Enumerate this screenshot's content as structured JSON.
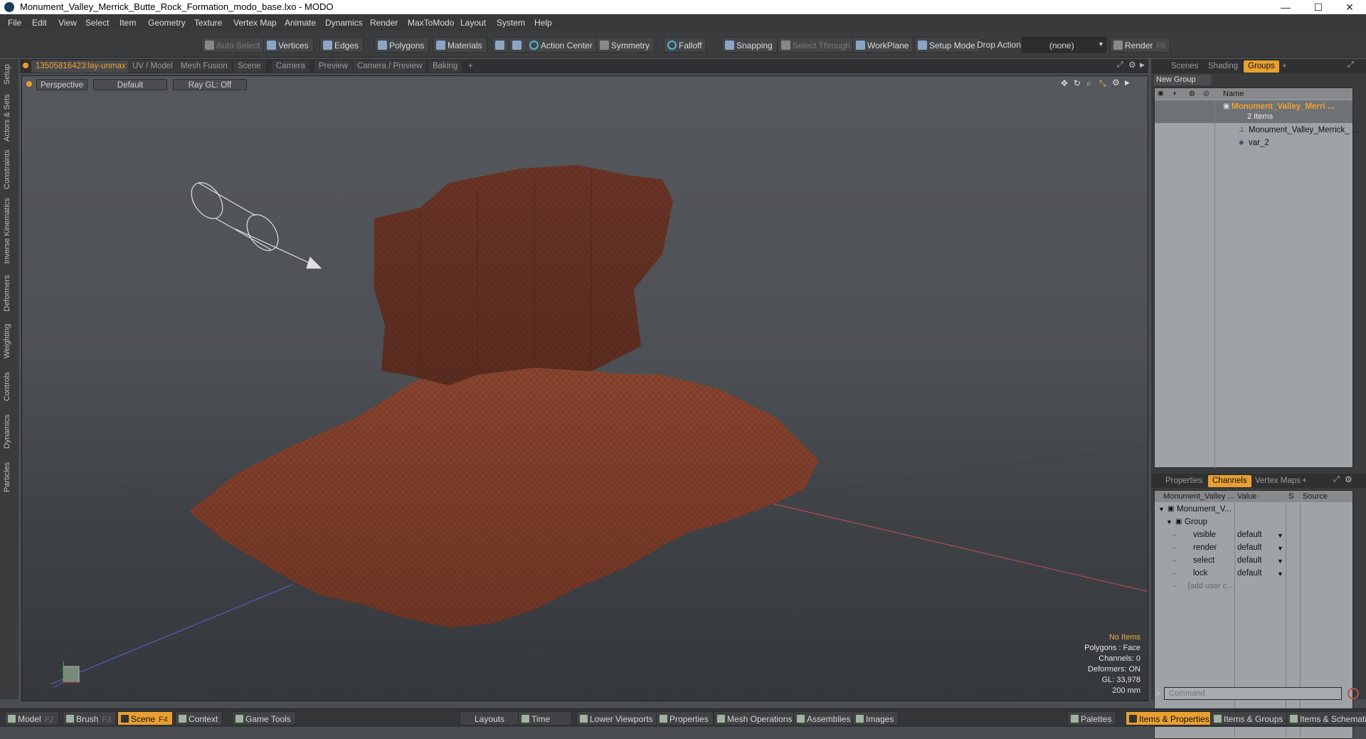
{
  "window": {
    "title": "Monument_Valley_Merrick_Butte_Rock_Formation_modo_base.lxo - MODO",
    "minimize": "—",
    "maximize": "☐",
    "close": "✕"
  },
  "menu": [
    "File",
    "Edit",
    "View",
    "Select",
    "Item",
    "Geometry",
    "Texture",
    "Vertex Map",
    "Animate",
    "Dynamics",
    "Render",
    "MaxToModo",
    "Layout",
    "System",
    "Help"
  ],
  "toolbar": {
    "auto_select": "Auto Select",
    "vertices": "Vertices",
    "edges": "Edges",
    "polygons": "Polygons",
    "materials": "Materials",
    "action_center": "Action Center",
    "symmetry": "Symmetry",
    "falloff": "Falloff",
    "snapping": "Snapping",
    "select_through": "Select Through",
    "workplane": "WorkPlane",
    "setup_mode": "Setup Mode",
    "drop_action": "Drop Action",
    "drop_value": "(none)",
    "render": "Render",
    "render_key": "F9"
  },
  "viewport_tabs": [
    "13505816423:lay-unmax",
    "UV / Model",
    "Mesh Fusion",
    "Scene",
    "Camera",
    "Preview",
    "Camera / Preview",
    "Baking",
    "+"
  ],
  "left_tabs": [
    "Setup",
    "Actors & Sets",
    "Constraints",
    "Inverse Kinematics",
    "Deformers",
    "Weighting",
    "Controls",
    "Dynamics",
    "Particles"
  ],
  "viewport": {
    "view": "Perspective",
    "shading": "Default",
    "raygl": "Ray GL: Off",
    "info": {
      "items": "No Items",
      "polygons": "Polygons : Face",
      "channels": "Channels: 0",
      "deformers": "Deformers: ON",
      "gl": "GL: 33,978",
      "scale": "200 mm"
    }
  },
  "groups_panel": {
    "tabs": [
      "Scenes",
      "Shading",
      "Groups",
      "+"
    ],
    "new_group": "New Group",
    "column_name": "Name",
    "group_name": "Monument_Valley_Merri ...",
    "group_count": "2 Items",
    "children": [
      "Monument_Valley_Merrick_ ...",
      "var_2"
    ]
  },
  "channels_panel": {
    "tabs": [
      "Properties",
      "Channels",
      "Vertex Maps",
      "+"
    ],
    "columns": [
      "Monument_Valley ...",
      "Value",
      "S",
      "Source"
    ],
    "item": "Monument_V...",
    "group": "Group",
    "rows": [
      {
        "name": "visible",
        "value": "default"
      },
      {
        "name": "render",
        "value": "default"
      },
      {
        "name": "select",
        "value": "default"
      },
      {
        "name": "lock",
        "value": "default"
      }
    ],
    "add_user": "{add user c..."
  },
  "command": {
    "placeholder": "Command",
    "prompt": ">"
  },
  "bottom": {
    "model": "Model",
    "model_key": "F2",
    "brush": "Brush",
    "brush_key": "F3",
    "scene": "Scene",
    "scene_key": "F4",
    "context": "Context",
    "game_tools": "Game Tools",
    "layouts": "Layouts",
    "time": "Time",
    "lower_viewports": "Lower Viewports",
    "properties": "Properties",
    "mesh_operations": "Mesh Operations",
    "assemblies": "Assemblies",
    "images": "Images",
    "palettes": "Palettes",
    "items_properties": "Items & Properties",
    "items_groups": "Items & Groups",
    "items_scheme": "Items & Schematic"
  },
  "colors": {
    "accent": "#e8a030",
    "rock": "#7a3a26",
    "axis_red": "#b05050",
    "axis_blue": "#5060c0"
  }
}
